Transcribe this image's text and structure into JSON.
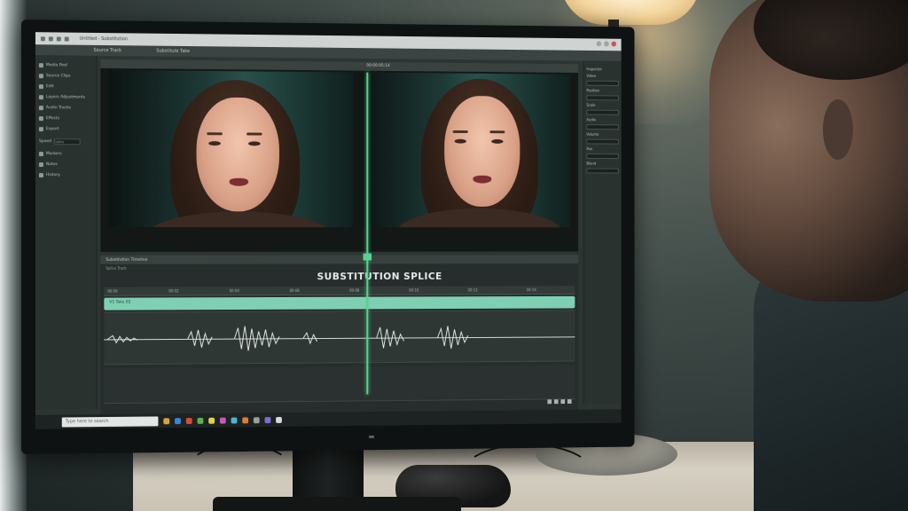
{
  "window": {
    "title": "Untitled - Substitution"
  },
  "menubar": {
    "items": [
      "Source Track",
      "Substitute Take"
    ]
  },
  "sidebar": {
    "items": [
      {
        "icon": "folder-icon",
        "label": "Media Pool"
      },
      {
        "icon": "film-icon",
        "label": "Source Clips"
      },
      {
        "icon": "scissors-icon",
        "label": "Edit"
      },
      {
        "icon": "layers-icon",
        "label": "Layers Adjustments"
      },
      {
        "icon": "waveform-icon",
        "label": "Audio Tracks"
      },
      {
        "icon": "sliders-icon",
        "label": "Effects"
      },
      {
        "icon": "gear-icon",
        "label": "Export"
      }
    ],
    "field_label": "Speed",
    "field_value": "100%",
    "lower_items": [
      {
        "icon": "marker-icon",
        "label": "Markers"
      },
      {
        "icon": "flag-icon",
        "label": "Notes"
      },
      {
        "icon": "list-icon",
        "label": "History"
      }
    ]
  },
  "viewer": {
    "header_label": "00:00:05:14"
  },
  "right_panel": {
    "title": "Inspector",
    "rows": [
      "Video",
      "Position",
      "Scale",
      "Audio",
      "Volume",
      "Pan",
      "Blend"
    ]
  },
  "timeline": {
    "header": "Substitution Timeline",
    "sub_header": "Splice Track",
    "overlay_title": "SUBSTITUTION SPLICE",
    "ruler_ticks": [
      "00:00",
      "00:02",
      "00:04",
      "00:06",
      "00:08",
      "00:10",
      "00:12",
      "00:14"
    ],
    "video_clip_label": "V1 Take 02",
    "audio_track_label": "A1"
  },
  "taskbar": {
    "search_placeholder": "Type here to search",
    "app_colors": [
      "#d9a33a",
      "#3c86d9",
      "#d94a3c",
      "#5bb04f",
      "#e0d24a",
      "#c25ab8",
      "#4ab7c9",
      "#e07a3c",
      "#9e9e9e",
      "#7a6fd9",
      "#d9d9d9"
    ]
  },
  "colors": {
    "accent": "#56d38d",
    "clip": "#7fd0b2"
  }
}
